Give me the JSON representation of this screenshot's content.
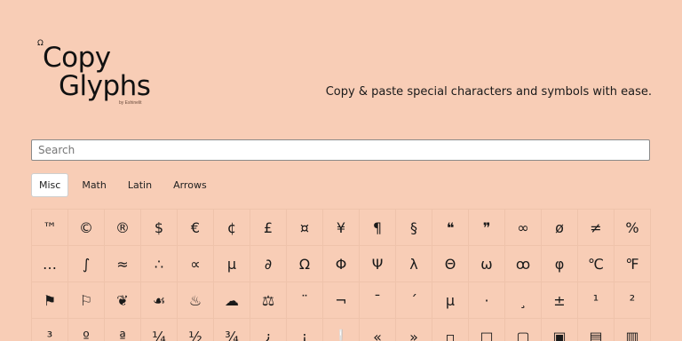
{
  "logo": {
    "mark": "Ω",
    "word1": "Copy",
    "word2": "Glyphs",
    "byline": "by Eshinelit"
  },
  "tagline": "Copy & paste special characters and symbols with ease.",
  "search": {
    "placeholder": "Search",
    "value": ""
  },
  "tabs": [
    {
      "label": "Misc",
      "active": true
    },
    {
      "label": "Math",
      "active": false
    },
    {
      "label": "Latin",
      "active": false
    },
    {
      "label": "Arrows",
      "active": false
    }
  ],
  "glyphs": [
    "™",
    "©",
    "®",
    "$",
    "€",
    "¢",
    "£",
    "¤",
    "¥",
    "¶",
    "§",
    "❝",
    "❞",
    "∞",
    "ø",
    "≠",
    "%",
    "…",
    "∫",
    "≈",
    "∴",
    "∝",
    "µ",
    "∂",
    "Ω",
    "Φ",
    "Ψ",
    "λ",
    "Θ",
    "ω",
    "ꝏ",
    "φ",
    "℃",
    "℉",
    "⚑",
    "⚐",
    "❦",
    "☙",
    "♨",
    "☁",
    "⚖",
    "¨",
    "¬",
    "¯",
    "´",
    "µ",
    "·",
    "¸",
    "±",
    "¹",
    "²",
    "³",
    "º",
    "ª",
    "¼",
    "½",
    "¾",
    "¿",
    "¡",
    "❕",
    "«",
    "»",
    "▫",
    "□",
    "▢",
    "▣",
    "▤",
    "▥"
  ]
}
